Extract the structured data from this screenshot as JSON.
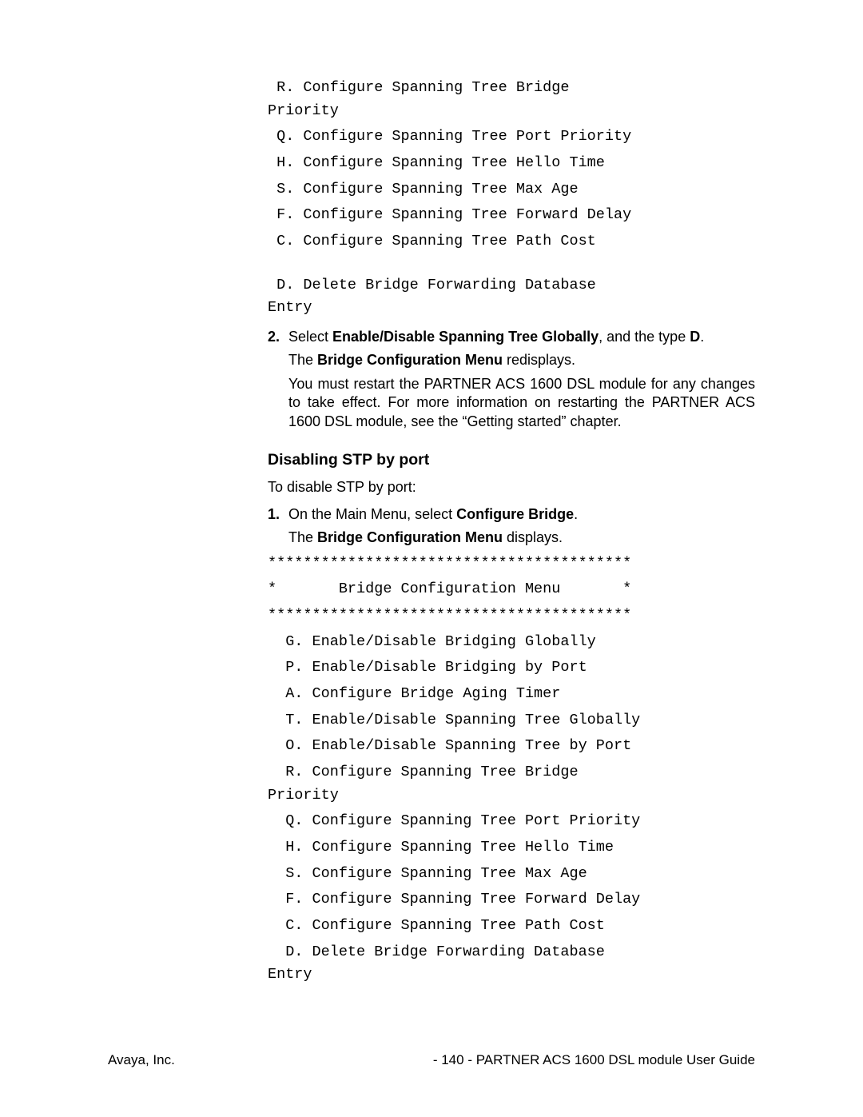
{
  "top_menu": {
    "r": " R. Configure Spanning Tree Bridge\nPriority",
    "q": " Q. Configure Spanning Tree Port Priority",
    "h": " H. Configure Spanning Tree Hello Time",
    "s": " S. Configure Spanning Tree Max Age",
    "f": " F. Configure Spanning Tree Forward Delay",
    "c": " C. Configure Spanning Tree Path Cost",
    "d": " D. Delete Bridge Forwarding Database\nEntry"
  },
  "step2": {
    "num": "2.",
    "t1": "Select ",
    "bold1": "Enable/Disable Spanning Tree Globally",
    "t2": ", and the type ",
    "bold2": "D",
    "t3": ".",
    "line2a": "The ",
    "line2bold": "Bridge Configuration Menu",
    "line2b": " redisplays.",
    "line3": "You must restart the PARTNER ACS 1600 DSL module for any changes to take effect.  For more information on restarting the PARTNER ACS 1600 DSL module, see the “Getting started” chapter."
  },
  "section_heading": "Disabling STP by port",
  "intro": "To disable STP by port:",
  "step1": {
    "num": "1.",
    "t1": "On the Main Menu, select ",
    "bold1": "Configure Bridge",
    "t2": ".",
    "line2a": "The ",
    "line2bold": "Bridge Configuration Menu",
    "line2b": " displays."
  },
  "menu": {
    "stars": "*****************************************",
    "title": "*       Bridge Configuration Menu       *",
    "g": "  G. Enable/Disable Bridging Globally",
    "p": "  P. Enable/Disable Bridging by Port",
    "a": "  A. Configure Bridge Aging Timer",
    "t": "  T. Enable/Disable Spanning Tree Globally",
    "o": "  O. Enable/Disable Spanning Tree by Port",
    "r": "  R. Configure Spanning Tree Bridge\nPriority",
    "q": "  Q. Configure Spanning Tree Port Priority",
    "h": "  H. Configure Spanning Tree Hello Time",
    "s": "  S. Configure Spanning Tree Max Age",
    "f": "  F. Configure Spanning Tree Forward Delay",
    "c": "  C. Configure Spanning Tree Path Cost",
    "d": "  D. Delete Bridge Forwarding Database\nEntry"
  },
  "footer": {
    "left": "Avaya, Inc.",
    "right": "- 140 - PARTNER ACS 1600 DSL module User Guide"
  }
}
